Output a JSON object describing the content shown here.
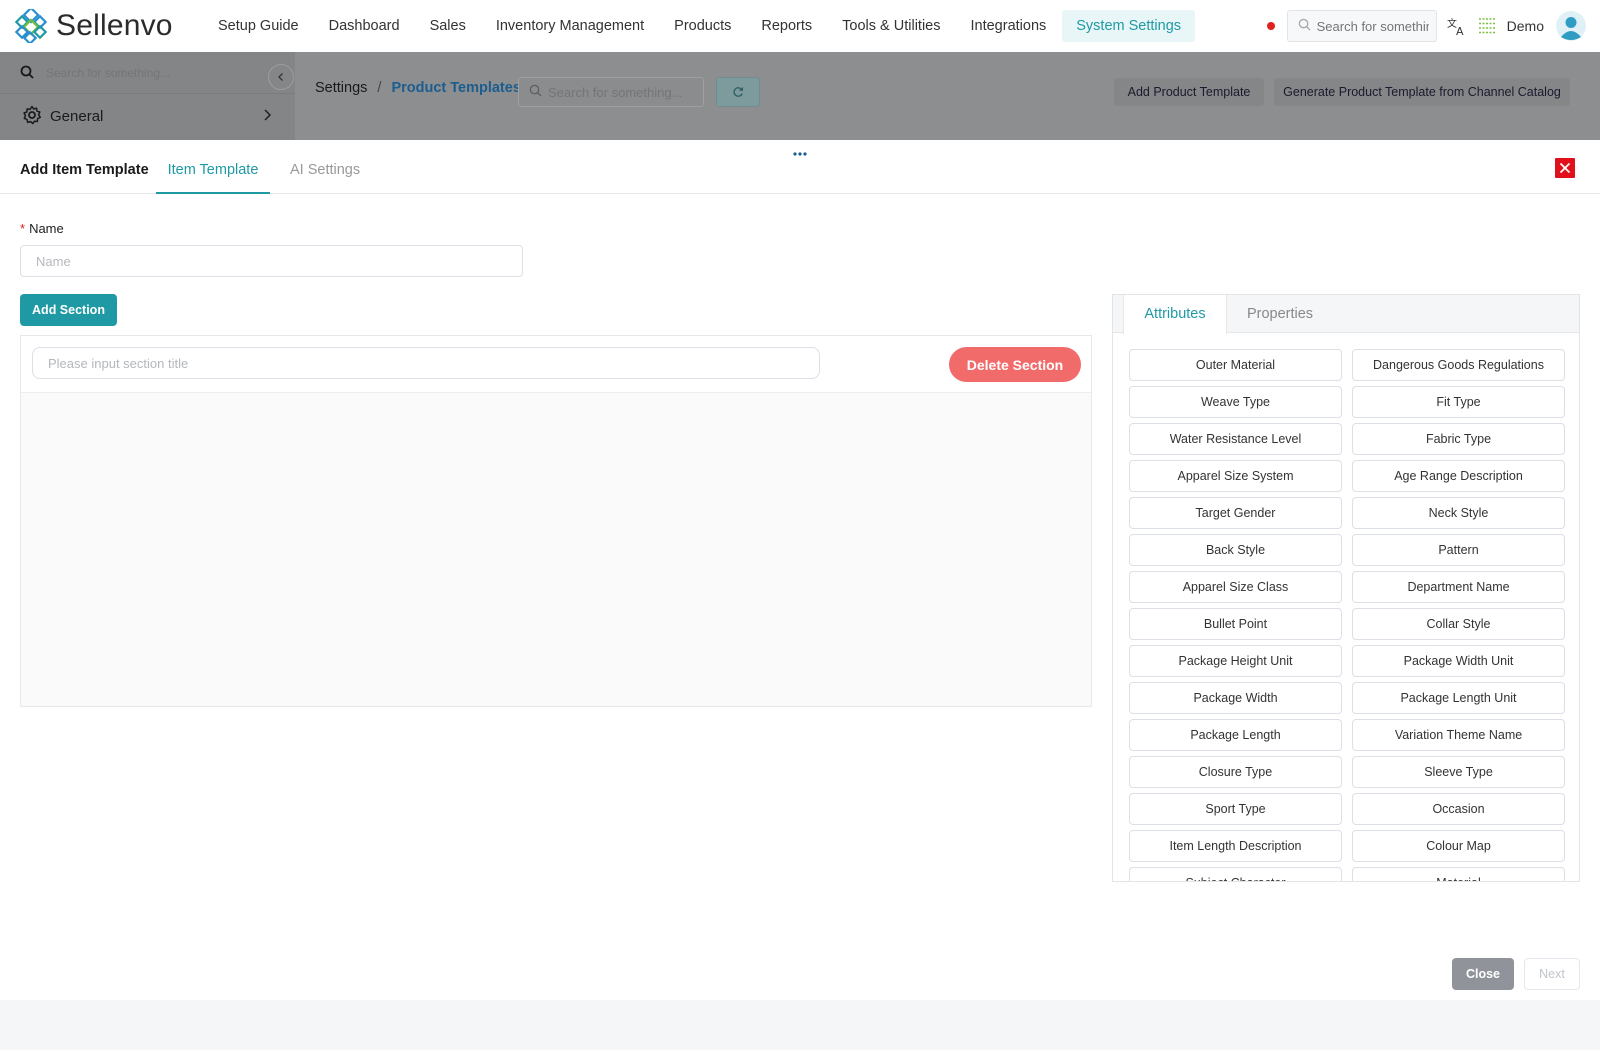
{
  "app": {
    "logo_text": "Sellenvo",
    "nav": [
      "Setup Guide",
      "Dashboard",
      "Sales",
      "Inventory Management",
      "Products",
      "Reports",
      "Tools & Utilities",
      "Integrations",
      "System Settings"
    ],
    "active_nav": "System Settings",
    "search_placeholder": "Search for something...",
    "user_label": "Demo",
    "accent_color": "#1f9aa5"
  },
  "sidebar": {
    "search_placeholder": "Search for something...",
    "items": [
      {
        "label": "General"
      }
    ]
  },
  "page": {
    "breadcrumb": [
      "Settings",
      "Product Templates"
    ],
    "search_placeholder": "Search for something...",
    "actions": [
      "Add Product Template",
      "Generate Product Template from Channel Catalog"
    ]
  },
  "drawer": {
    "title": "Add Item Template",
    "tabs": [
      "Item Template",
      "AI Settings"
    ],
    "active_tab": "Item Template",
    "name_label": "Name",
    "name_placeholder": "Name",
    "name_value": "",
    "add_section_label": "Add Section",
    "section_title_placeholder": "Please input section title",
    "delete_section_label": "Delete Section",
    "attr_tabs": [
      "Attributes",
      "Properties"
    ],
    "attributes": [
      "Outer Material",
      "Dangerous Goods Regulations",
      "Weave Type",
      "Fit Type",
      "Water Resistance Level",
      "Fabric Type",
      "Apparel Size System",
      "Age Range Description",
      "Target Gender",
      "Neck Style",
      "Back Style",
      "Pattern",
      "Apparel Size Class",
      "Department Name",
      "Bullet Point",
      "Collar Style",
      "Package Height Unit",
      "Package Width Unit",
      "Package Width",
      "Package Length Unit",
      "Package Length",
      "Variation Theme Name",
      "Closure Type",
      "Sleeve Type",
      "Sport Type",
      "Occasion",
      "Item Length Description",
      "Colour Map",
      "Subject Character",
      "Material"
    ],
    "close_label": "Close",
    "next_label": "Next"
  }
}
